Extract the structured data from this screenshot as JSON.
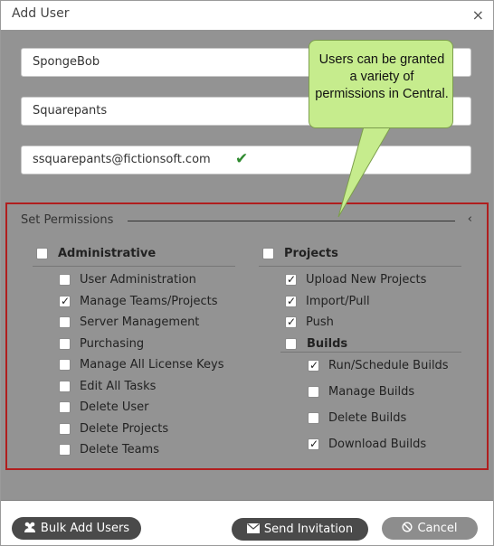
{
  "dialog": {
    "title": "Add User",
    "close_icon": "×"
  },
  "fields": {
    "first_name": "SpongeBob",
    "last_name": "Squarepants",
    "email": "ssquarepants@fictionsoft.com",
    "email_valid_icon": "check-icon"
  },
  "callout": {
    "text": "Users can be granted a variety of permissions in Central."
  },
  "permissions": {
    "title": "Set Permissions",
    "collapse_icon": "‹",
    "administrative": {
      "label": "Administrative",
      "checked": false,
      "items": [
        {
          "label": "User Administration",
          "checked": false
        },
        {
          "label": "Manage Teams/Projects",
          "checked": true
        },
        {
          "label": "Server Management",
          "checked": false
        },
        {
          "label": "Purchasing",
          "checked": false
        },
        {
          "label": "Manage All License Keys",
          "checked": false
        },
        {
          "label": "Edit All Tasks",
          "checked": false
        },
        {
          "label": "Delete User",
          "checked": false
        },
        {
          "label": "Delete Projects",
          "checked": false
        },
        {
          "label": "Delete Teams",
          "checked": false
        }
      ]
    },
    "projects": {
      "label": "Projects",
      "checked": false,
      "items": [
        {
          "label": "Upload New Projects",
          "checked": true
        },
        {
          "label": "Import/Pull",
          "checked": true
        },
        {
          "label": "Push",
          "checked": true
        }
      ]
    },
    "builds": {
      "label": "Builds",
      "checked": false,
      "items": [
        {
          "label": "Run/Schedule Builds",
          "checked": true
        },
        {
          "label": "Manage Builds",
          "checked": false
        },
        {
          "label": "Delete Builds",
          "checked": false
        },
        {
          "label": "Download Builds",
          "checked": true
        }
      ]
    }
  },
  "footer": {
    "bulk_add_label": "Bulk Add Users",
    "send_invitation_label": "Send Invitation",
    "cancel_label": "Cancel"
  }
}
